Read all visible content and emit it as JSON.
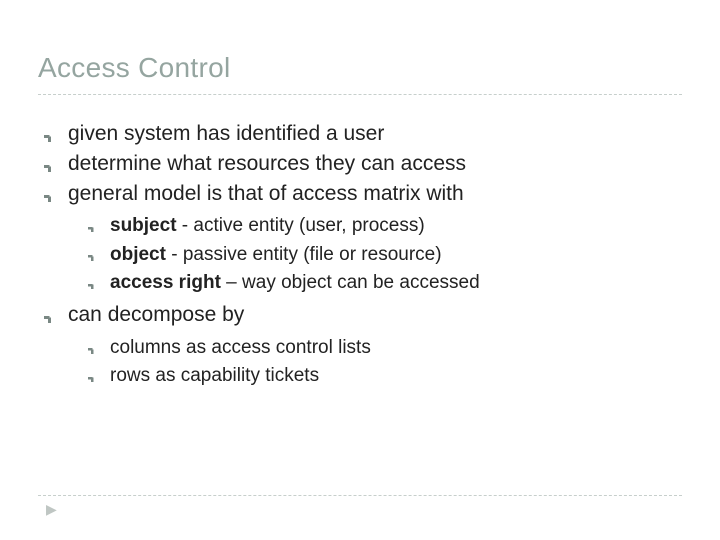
{
  "title": "Access Control",
  "items": [
    {
      "text": "given system has identified a user"
    },
    {
      "text": "determine what resources they can access"
    },
    {
      "text": "general model is that of access matrix with",
      "sub": [
        {
          "bold": "subject",
          "rest": " - active entity (user, process)"
        },
        {
          "bold": "object",
          "rest": " - passive entity (file or resource)"
        },
        {
          "bold": "access right",
          "rest": " – way object can be accessed"
        }
      ]
    },
    {
      "text": "can decompose by",
      "sub": [
        {
          "rest": "columns as access control lists"
        },
        {
          "rest": "rows as capability tickets"
        }
      ]
    }
  ]
}
